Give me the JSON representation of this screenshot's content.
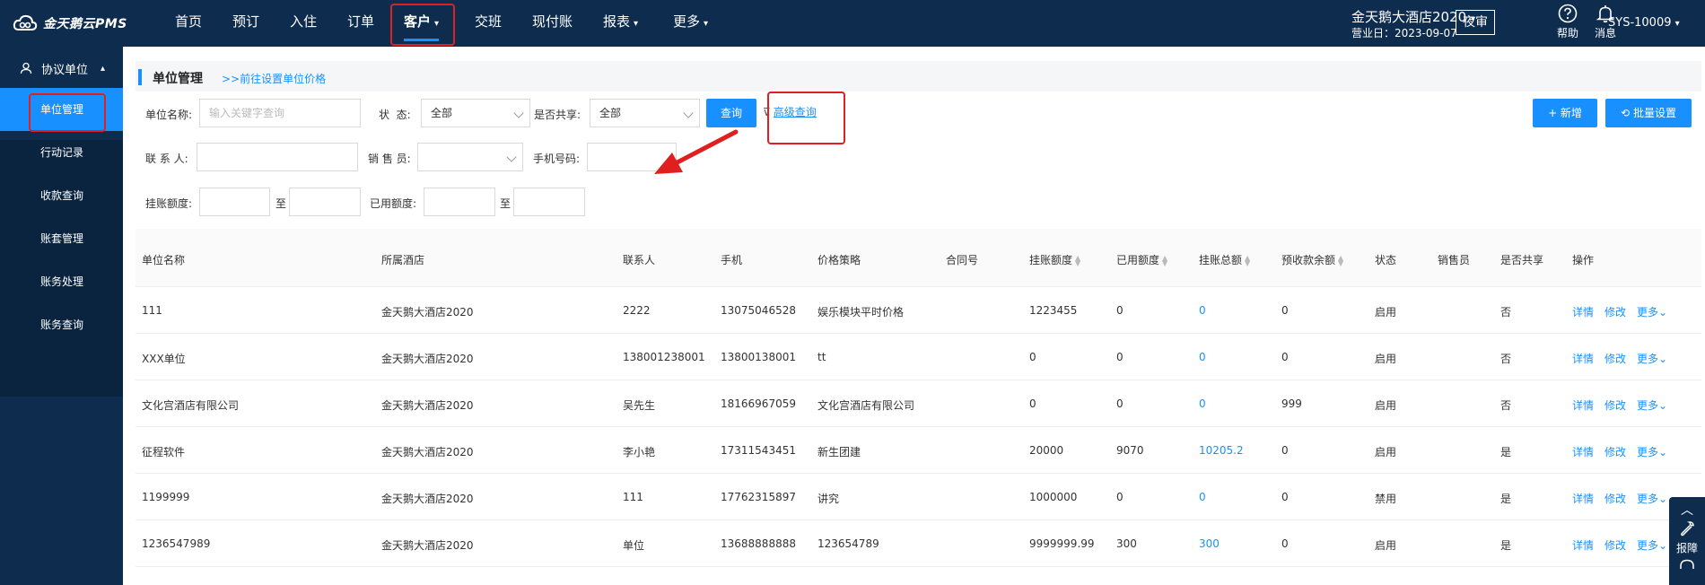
{
  "app": {
    "brand": "金天鹅云PMS"
  },
  "nav": {
    "items": [
      {
        "label": "首页",
        "dropdown": false
      },
      {
        "label": "预订",
        "dropdown": false
      },
      {
        "label": "入住",
        "dropdown": false
      },
      {
        "label": "订单",
        "dropdown": false
      },
      {
        "label": "客户",
        "dropdown": true,
        "active": true
      },
      {
        "label": "交班",
        "dropdown": false
      },
      {
        "label": "现付账",
        "dropdown": false
      },
      {
        "label": "报表",
        "dropdown": true
      },
      {
        "label": "更多",
        "dropdown": true
      }
    ]
  },
  "header": {
    "hotel_name": "金天鹅大酒店2020",
    "business_date": "营业日：2023-09-07",
    "night_audit": "夜审",
    "help": "帮助",
    "messages": "消息",
    "user": "SYS-10009"
  },
  "sidebar": {
    "section": "协议单位",
    "items": [
      {
        "label": "单位管理",
        "active": true
      },
      {
        "label": "行动记录"
      },
      {
        "label": "收款查询"
      },
      {
        "label": "账套管理"
      },
      {
        "label": "账务处理"
      },
      {
        "label": "账务查询"
      }
    ]
  },
  "page": {
    "title": "单位管理",
    "price_link": ">>前往设置单位价格"
  },
  "filters": {
    "unit_name_label": "单位名称:",
    "unit_name_placeholder": "输入关键字查询",
    "status_label": "状  态:",
    "status_value": "全部",
    "shared_label": "是否共享:",
    "shared_value": "全部",
    "query_button": "查询",
    "advanced_query": "高级查询",
    "add_button": "+ 新增",
    "batch_button": "批量设置",
    "contact_label": "联 系 人:",
    "sales_label": "销 售 员:",
    "phone_label": "手机号码:",
    "credit_label": "挂账额度:",
    "to_label": "至",
    "used_label": "已用额度:"
  },
  "table": {
    "headers": [
      "单位名称",
      "所属酒店",
      "联系人",
      "手机",
      "价格策略",
      "合同号",
      "挂账额度",
      "已用额度",
      "挂账总额",
      "预收款余额",
      "状态",
      "销售员",
      "是否共享",
      "操作"
    ],
    "rows": [
      [
        "111",
        "金天鹅大酒店2020",
        "2222",
        "13075046528",
        "娱乐模块平时价格",
        "",
        "1223455",
        "0",
        "0",
        "0",
        "启用",
        "",
        "否"
      ],
      [
        "XXX单位",
        "金天鹅大酒店2020",
        "138001238001",
        "13800138001",
        "tt",
        "",
        "0",
        "0",
        "0",
        "0",
        "启用",
        "",
        "否"
      ],
      [
        "文化宫酒店有限公司",
        "金天鹅大酒店2020",
        "吴先生",
        "18166967059",
        "文化宫酒店有限公司",
        "",
        "0",
        "0",
        "0",
        "999",
        "启用",
        "",
        "否"
      ],
      [
        "征程软件",
        "金天鹅大酒店2020",
        "李小艳",
        "17311543451",
        "新生团建",
        "",
        "20000",
        "9070",
        "10205.2",
        "0",
        "启用",
        "",
        "是"
      ],
      [
        "1199999",
        "金天鹅大酒店2020",
        "111",
        "17762315897",
        "讲究",
        "",
        "1000000",
        "0",
        "0",
        "0",
        "禁用",
        "",
        "是"
      ],
      [
        "1236547989",
        "金天鹅大酒店2020",
        "单位",
        "13688888888",
        "123654789",
        "",
        "9999999.99",
        "300",
        "300",
        "0",
        "启用",
        "",
        "是"
      ]
    ],
    "ops": {
      "detail": "详情",
      "edit": "修改",
      "more": "更多"
    }
  },
  "float_tool": {
    "label": "报障"
  },
  "colors": {
    "nav_bg": "#0e2c4e",
    "accent": "#1890ff",
    "annotation": "#e02020"
  }
}
